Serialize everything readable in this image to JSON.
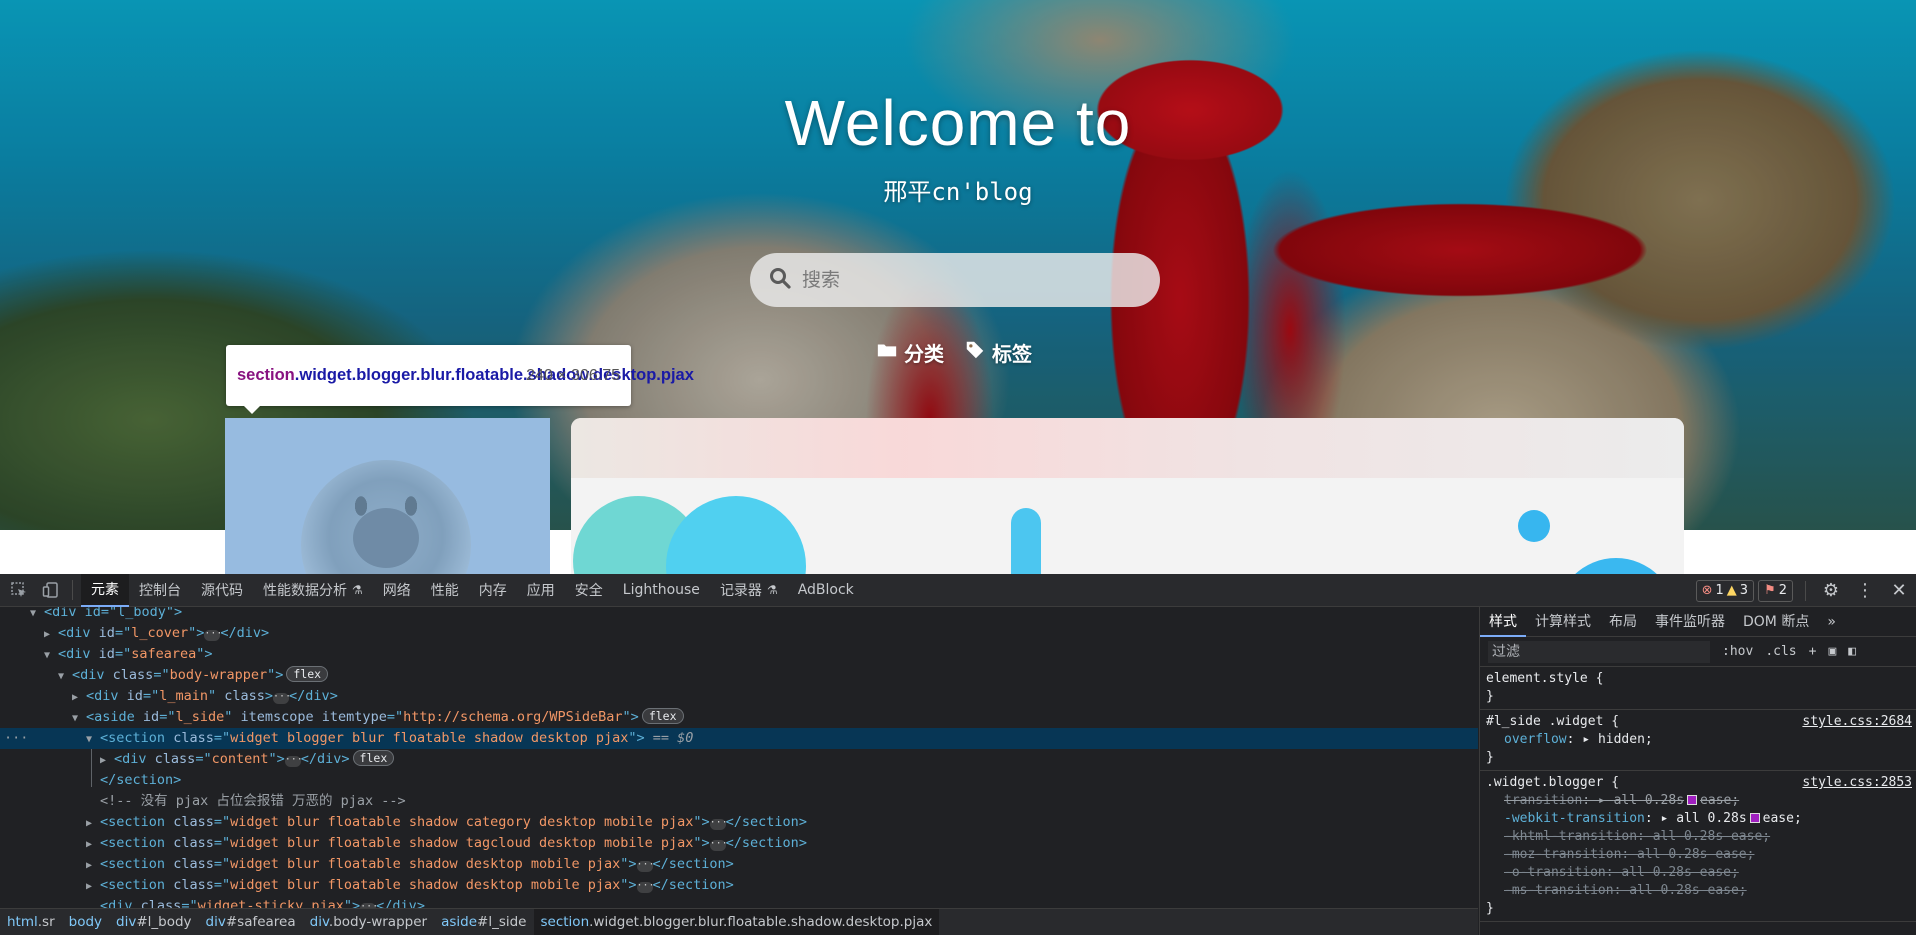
{
  "page": {
    "hero": {
      "title": "Welcome to",
      "subtitle": "邢平cn'blog",
      "search_placeholder": "搜索",
      "nav": [
        {
          "label": "分类",
          "icon": "folder-icon"
        },
        {
          "label": "标签",
          "icon": "tag-icon"
        }
      ]
    },
    "tooltip": {
      "selector_tag": "section",
      "selector_classes": ".widget.blogger.blur.floatable.shadow.desktop.pjax",
      "dimensions": "240 × 306.75"
    }
  },
  "devtools": {
    "tabs": [
      "元素",
      "控制台",
      "源代码",
      "性能数据分析",
      "网络",
      "性能",
      "内存",
      "应用",
      "安全",
      "Lighthouse",
      "记录器",
      "AdBlock"
    ],
    "active_tab": "元素",
    "badges": {
      "errors": "1",
      "warnings": "3",
      "issues": "2"
    },
    "dom": {
      "line0": {
        "text": "<div id=\"l_body\">"
      },
      "line1": {
        "tag": "div",
        "attr": "id",
        "val": "l_cover"
      },
      "line2": {
        "tag": "div",
        "attr": "id",
        "val": "safearea"
      },
      "line3": {
        "tag": "div",
        "attr": "class",
        "val": "body-wrapper",
        "badge": "flex"
      },
      "line4": {
        "tag": "div",
        "attr": "id",
        "val": "l_main",
        "attr2": "class"
      },
      "line5": {
        "tag": "aside",
        "attr": "id",
        "val": "l_side",
        "attr2": "itemscope",
        "attr3": "itemtype",
        "val3": "http://schema.org/WPSideBar",
        "badge": "flex"
      },
      "line6": {
        "tag": "section",
        "attr": "class",
        "val": "widget blogger blur floatable shadow desktop pjax",
        "eq": "== $0"
      },
      "line7": {
        "tag": "div",
        "attr": "class",
        "val": "content",
        "badge": "flex"
      },
      "line8": {
        "tag": "/section"
      },
      "line9": {
        "comment": "<!-- 没有 pjax 占位会报错 万恶的 pjax -->"
      },
      "line10": {
        "tag": "section",
        "attr": "class",
        "val": "widget blur floatable shadow category desktop mobile pjax"
      },
      "line11": {
        "tag": "section",
        "attr": "class",
        "val": "widget blur floatable shadow tagcloud desktop mobile pjax"
      },
      "line12": {
        "tag": "section",
        "attr": "class",
        "val": "widget blur floatable shadow desktop mobile pjax"
      },
      "line13": {
        "tag": "section",
        "attr": "class",
        "val": "widget blur floatable shadow desktop mobile pjax"
      },
      "line14": {
        "tag": "div",
        "attr": "class",
        "val": "widget-sticky pjax"
      }
    },
    "breadcrumbs": [
      {
        "tag": "html",
        "rest": ".sr"
      },
      {
        "tag": "body",
        "rest": ""
      },
      {
        "tag": "div",
        "rest": "#l_body"
      },
      {
        "tag": "div",
        "rest": "#safearea"
      },
      {
        "tag": "div",
        "rest": ".body-wrapper"
      },
      {
        "tag": "aside",
        "rest": "#l_side"
      },
      {
        "tag": "section",
        "rest": ".widget.blogger.blur.floatable.shadow.desktop.pjax"
      }
    ],
    "styles": {
      "tabs": [
        "样式",
        "计算样式",
        "布局",
        "事件监听器",
        "DOM 断点"
      ],
      "filter_placeholder": "过滤",
      "hov": ":hov",
      "cls": ".cls",
      "element_style": "element.style {",
      "rule1": {
        "selector": "#l_side .widget {",
        "source": "style.css:2684",
        "prop": "overflow",
        "value": "hidden;"
      },
      "rule2": {
        "selector": ".widget.blogger {",
        "source": "style.css:2853",
        "p1": "transition",
        "v1a": "all 0.28s",
        "v1b": "ease;",
        "p2": "-webkit-transition",
        "v2a": "all 0.28s",
        "v2b": "ease;",
        "l3": "-khtml-transition: all 0.28s ease;",
        "l4": "-moz-transition: all 0.28s ease;",
        "l5": "-o-transition: all 0.28s ease;",
        "l6": "-ms-transition: all 0.28s ease;"
      }
    }
  }
}
